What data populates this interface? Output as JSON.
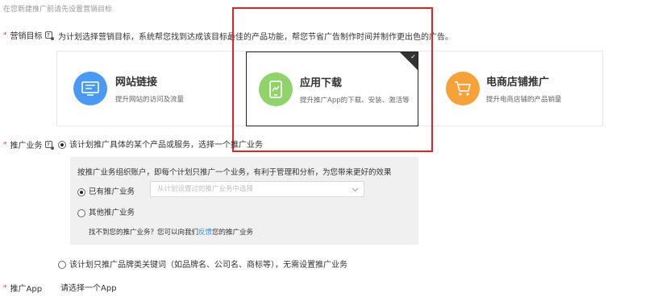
{
  "hint": "在您新建推广前请先设置营销目标",
  "marketing": {
    "required": "*",
    "label": "营销目标",
    "description": "为计划选择营销目标，系统帮您找到达成该目标最佳的产品功能，帮您节省广告制作时间并制作更出色的广告。",
    "cards": [
      {
        "title": "网站链接",
        "subtitle": "提升网站的访问及流量",
        "color": "#4a9af4",
        "icon": "monitor-icon"
      },
      {
        "title": "应用下载",
        "subtitle": "提升推广App的下载、安装、激活等",
        "color": "#8fd36a",
        "icon": "mobile-app-icon",
        "selected": true,
        "check": "✓"
      },
      {
        "title": "电商店铺推广",
        "subtitle": "提升电商店铺的产品销量",
        "color": "#f6a13a",
        "icon": "shopping-cart-icon"
      }
    ]
  },
  "business": {
    "required": "*",
    "label": "推广业务",
    "option1": "该计划推广具体的某个产品或服务，选择一个推广业务",
    "panel": {
      "intro": "按推广业务组织账户，即每个计划只推广一个业务，有利于管理和分析，为您带来更好的效果",
      "existing_label": "已有推广业务",
      "select_placeholder": "从计划设置过的推广业务中选择",
      "other_label": "其他推广业务",
      "feedback_prefix": "找不到您的推广业务？您可以向我们",
      "feedback_link": "反馈",
      "feedback_suffix": "您的推广业务"
    },
    "option2": "该计划只推广品牌类关键词（如品牌名、公司名、商标等），无需设置推广业务"
  },
  "app": {
    "required": "*",
    "label": "推广App",
    "prompt": "请选择一个App"
  }
}
